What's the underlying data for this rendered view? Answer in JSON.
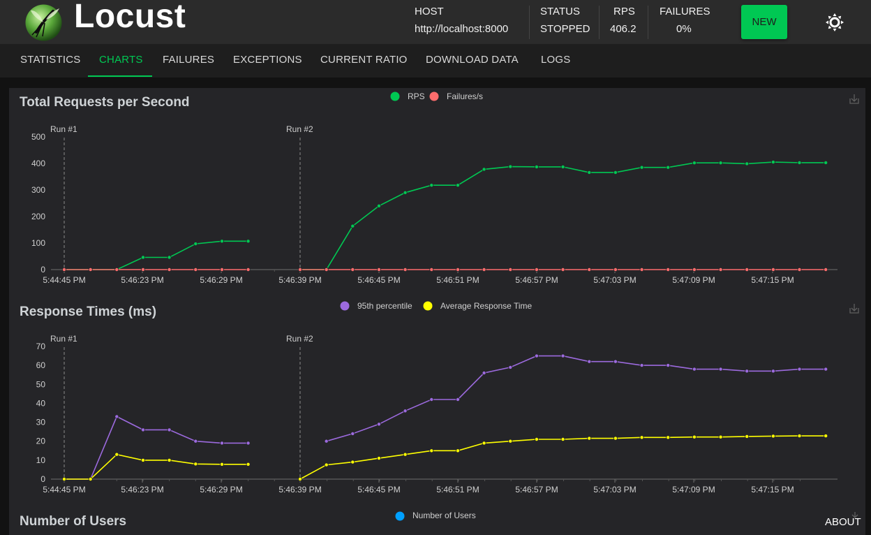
{
  "app": {
    "logo_text": "Locust"
  },
  "header": {
    "host": {
      "label": "HOST",
      "value": "http://localhost:8000"
    },
    "status": {
      "label": "STATUS",
      "value": "STOPPED"
    },
    "rps": {
      "label": "RPS",
      "value": "406.2"
    },
    "failures": {
      "label": "FAILURES",
      "value": "0%"
    },
    "new_button": "NEW",
    "theme_icon": "sun-icon"
  },
  "tabs": [
    {
      "label": "STATISTICS",
      "active": false
    },
    {
      "label": "CHARTS",
      "active": true
    },
    {
      "label": "FAILURES",
      "active": false
    },
    {
      "label": "EXCEPTIONS",
      "active": false
    },
    {
      "label": "CURRENT RATIO",
      "active": false
    },
    {
      "label": "DOWNLOAD DATA",
      "active": false
    },
    {
      "label": "LOGS",
      "active": false
    }
  ],
  "footer": {
    "about": "ABOUT"
  },
  "colors": {
    "accent": "#00c853",
    "rps": "#00c853",
    "failures": "#ff6d6d",
    "p95": "#9c6ade",
    "avg": "#ffff00",
    "users": "#00a0ff"
  },
  "chart_data": [
    {
      "type": "line",
      "title": "Total Requests per Second",
      "run_markers": [
        "Run #1",
        "Run #2"
      ],
      "x_tick_labels": [
        "5:44:45 PM",
        "5:46:23 PM",
        "5:46:29 PM",
        "5:46:39 PM",
        "5:46:45 PM",
        "5:46:51 PM",
        "5:46:57 PM",
        "5:47:03 PM",
        "5:47:09 PM",
        "5:47:15 PM"
      ],
      "y_ticks": [
        0,
        100,
        200,
        300,
        400,
        500
      ],
      "ylim": [
        0,
        500
      ],
      "series": [
        {
          "name": "RPS",
          "runs": [
            [
              0,
              0,
              0,
              46,
              46,
              97,
              107,
              107
            ],
            [
              0,
              0,
              164,
              240,
              290,
              318,
              318,
              378,
              388,
              387,
              387,
              366,
              366,
              385,
              385,
              402,
              402,
              399,
              405,
              403,
              403
            ]
          ]
        },
        {
          "name": "Failures/s",
          "runs": [
            [
              0,
              0,
              0,
              0,
              0,
              0,
              0,
              0
            ],
            [
              0,
              0,
              0,
              0,
              0,
              0,
              0,
              0,
              0,
              0,
              0,
              0,
              0,
              0,
              0,
              0,
              0,
              0,
              0,
              0,
              0
            ]
          ]
        }
      ]
    },
    {
      "type": "line",
      "title": "Response Times (ms)",
      "run_markers": [
        "Run #1",
        "Run #2"
      ],
      "x_tick_labels": [
        "5:44:45 PM",
        "5:46:23 PM",
        "5:46:29 PM",
        "5:46:39 PM",
        "5:46:45 PM",
        "5:46:51 PM",
        "5:46:57 PM",
        "5:47:03 PM",
        "5:47:09 PM",
        "5:47:15 PM"
      ],
      "y_ticks": [
        0,
        10,
        20,
        30,
        40,
        50,
        60,
        70
      ],
      "ylim": [
        0,
        70
      ],
      "series": [
        {
          "name": "95th percentile",
          "runs": [
            [
              0,
              0,
              33,
              26,
              26,
              20,
              19,
              19
            ],
            [
              null,
              20,
              24,
              29,
              36,
              42,
              42,
              56,
              59,
              65,
              65,
              62,
              62,
              60,
              60,
              58,
              58,
              57,
              57,
              58,
              58
            ]
          ]
        },
        {
          "name": "Average Response Time",
          "runs": [
            [
              0,
              0,
              13,
              10,
              10,
              8,
              7.8,
              7.8
            ],
            [
              0,
              7.5,
              9,
              11,
              13,
              15,
              15,
              19,
              20,
              21,
              21,
              21.5,
              21.5,
              22,
              22,
              22.2,
              22.2,
              22.5,
              22.7,
              22.8,
              22.8
            ]
          ]
        }
      ]
    },
    {
      "type": "line",
      "title": "Number of Users",
      "series": [
        {
          "name": "Number of Users"
        }
      ]
    }
  ]
}
